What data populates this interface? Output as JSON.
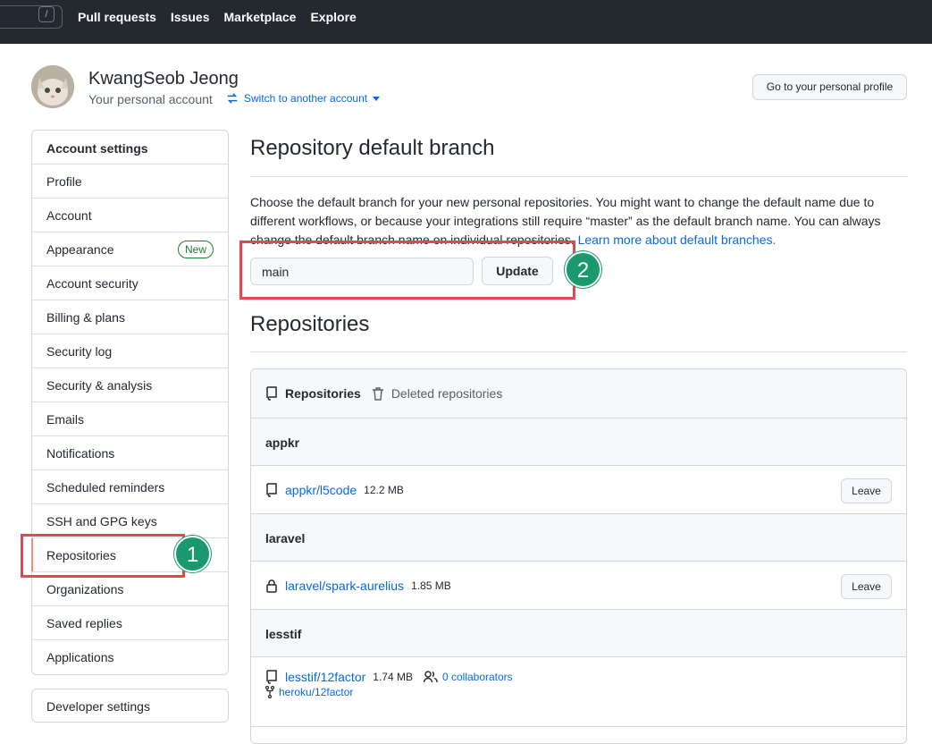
{
  "topnav": {
    "search_key": "/",
    "links": [
      "Pull requests",
      "Issues",
      "Marketplace",
      "Explore"
    ]
  },
  "account": {
    "name": "KwangSeob Jeong",
    "subtitle": "Your personal account",
    "switch_label": "Switch to another account",
    "profile_button": "Go to your personal profile"
  },
  "sidebar": {
    "header": "Account settings",
    "items": [
      {
        "label": "Profile"
      },
      {
        "label": "Account"
      },
      {
        "label": "Appearance",
        "badge": "New"
      },
      {
        "label": "Account security"
      },
      {
        "label": "Billing & plans"
      },
      {
        "label": "Security log"
      },
      {
        "label": "Security & analysis"
      },
      {
        "label": "Emails"
      },
      {
        "label": "Notifications"
      },
      {
        "label": "Scheduled reminders"
      },
      {
        "label": "SSH and GPG keys"
      },
      {
        "label": "Repositories",
        "selected": true
      },
      {
        "label": "Organizations"
      },
      {
        "label": "Saved replies"
      },
      {
        "label": "Applications"
      }
    ],
    "developer_settings": "Developer settings"
  },
  "main": {
    "title": "Repository default branch",
    "description": "Choose the default branch for your new personal repositories. You might want to change the default name due to different workflows, or because your integrations still require “master” as the default branch name. You can always change the default branch name on individual repositories.",
    "learn_more": "Learn more about default branches.",
    "branch_value": "main",
    "update_button": "Update",
    "repos_title": "Repositories",
    "tabs": {
      "active": "Repositories",
      "deleted": "Deleted repositories"
    },
    "groups": [
      {
        "org": "appkr",
        "repos": [
          {
            "name": "appkr/l5code",
            "size": "12.2 MB",
            "icon": "repo-icon",
            "action": "Leave"
          }
        ]
      },
      {
        "org": "laravel",
        "repos": [
          {
            "name": "laravel/spark-aurelius",
            "size": "1.85 MB",
            "icon": "lock-icon",
            "action": "Leave"
          }
        ]
      },
      {
        "org": "lesstif",
        "repos": [
          {
            "name": "lesstif/12factor",
            "size": "1.74 MB",
            "icon": "repo-icon",
            "collaborators": "0 collaborators",
            "fork_of": "heroku/12factor"
          }
        ]
      }
    ]
  },
  "annotations": {
    "step1": "1",
    "step2": "2"
  },
  "colors": {
    "accent": "#0969da",
    "highlight": "#e5474e",
    "callout": "#1a9a6c",
    "header_bg": "#24292f"
  }
}
